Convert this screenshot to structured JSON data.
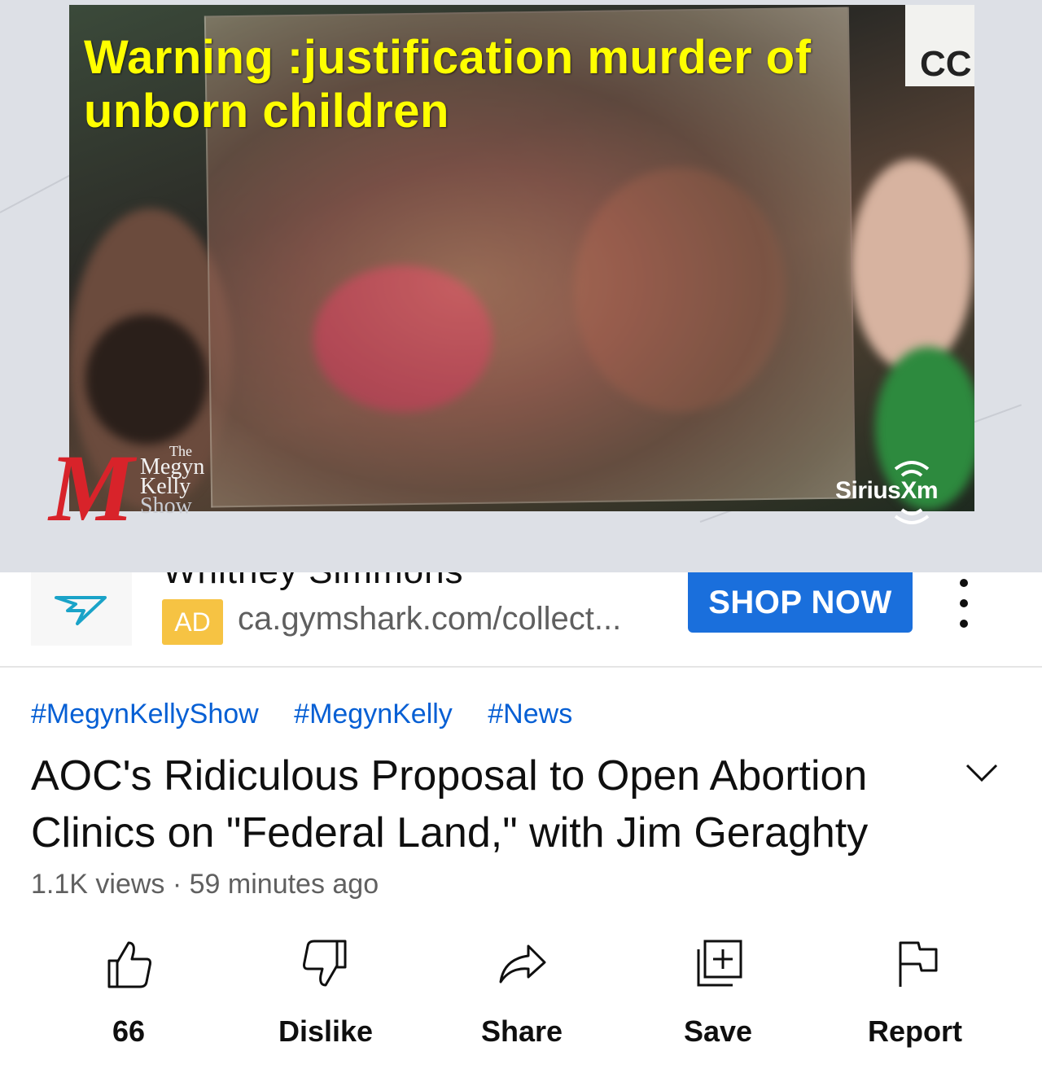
{
  "player": {
    "overlay_warning": "Warning :justification murder of unborn children",
    "sign_text": "CC",
    "show_logo": {
      "the": "The",
      "line1": "Megyn",
      "line2": "Kelly",
      "line3": "Show",
      "monogram": "M"
    },
    "network_logo": "SiriusXm"
  },
  "ad": {
    "title_cut": "Whitney Simmons",
    "badge": "AD",
    "url": "ca.gymshark.com/collect...",
    "cta_label": "SHOP NOW",
    "more_icon": "more-vert-icon",
    "brand_color": "#1a6fdc",
    "badge_color": "#f6c343"
  },
  "video": {
    "hashtags": [
      "#MegynKellyShow",
      "#MegynKelly",
      "#News"
    ],
    "title": "AOC's Ridiculous Proposal to Open Abortion Clinics on \"Federal Land,\" with Jim Geraghty",
    "views": "1.1K views",
    "separator": "·",
    "age": "59 minutes ago",
    "expand_icon": "chevron-down-icon"
  },
  "actions": [
    {
      "icon": "thumbs-up-icon",
      "label": "66"
    },
    {
      "icon": "thumbs-down-icon",
      "label": "Dislike"
    },
    {
      "icon": "share-icon",
      "label": "Share"
    },
    {
      "icon": "save-playlist-icon",
      "label": "Save"
    },
    {
      "icon": "flag-icon",
      "label": "Report"
    }
  ],
  "colors": {
    "link": "#065fd4",
    "warning_text": "#ffff00",
    "show_red": "#d8232a"
  }
}
